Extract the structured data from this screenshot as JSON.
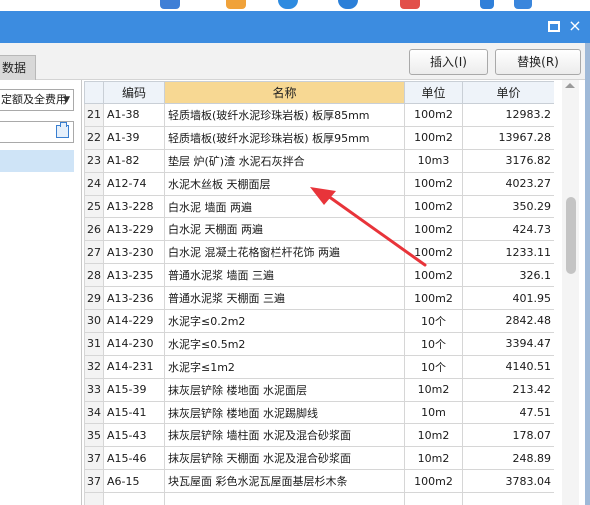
{
  "window": {
    "toolbar_icons": [
      "calendar-icon",
      "refresh-icon",
      "shield-icon",
      "globe-icon",
      "badge-icon",
      "user-icon",
      "grid-icon"
    ],
    "close_glyph": "×"
  },
  "toolbar": {
    "tab_label": "数据",
    "insert_label": "插入(I)",
    "replace_label": "替换(R)"
  },
  "left_panel": {
    "select_value": "定额及全费用"
  },
  "table": {
    "headers": [
      "编码",
      "名称",
      "单位",
      "单价"
    ],
    "rows": [
      {
        "idx": "21",
        "code": "A1-38",
        "name": "轻质墙板(玻纤水泥珍珠岩板) 板厚85mm",
        "unit": "100m2",
        "price": "12983.2"
      },
      {
        "idx": "22",
        "code": "A1-39",
        "name": "轻质墙板(玻纤水泥珍珠岩板) 板厚95mm",
        "unit": "100m2",
        "price": "13967.28"
      },
      {
        "idx": "23",
        "code": "A1-82",
        "name": "垫层 炉(矿)渣 水泥石灰拌合",
        "unit": "10m3",
        "price": "3176.82"
      },
      {
        "idx": "24",
        "code": "A12-74",
        "name": "水泥木丝板 天棚面层",
        "unit": "100m2",
        "price": "4023.27"
      },
      {
        "idx": "25",
        "code": "A13-228",
        "name": "白水泥 墙面 两遍",
        "unit": "100m2",
        "price": "350.29"
      },
      {
        "idx": "26",
        "code": "A13-229",
        "name": "白水泥 天棚面 两遍",
        "unit": "100m2",
        "price": "424.73"
      },
      {
        "idx": "27",
        "code": "A13-230",
        "name": "白水泥 混凝土花格窗栏杆花饰 两遍",
        "unit": "100m2",
        "price": "1233.11"
      },
      {
        "idx": "28",
        "code": "A13-235",
        "name": "普通水泥浆 墙面 三遍",
        "unit": "100m2",
        "price": "326.1"
      },
      {
        "idx": "29",
        "code": "A13-236",
        "name": "普通水泥浆 天棚面 三遍",
        "unit": "100m2",
        "price": "401.95"
      },
      {
        "idx": "30",
        "code": "A14-229",
        "name": "水泥字≤0.2m2",
        "unit": "10个",
        "price": "2842.48"
      },
      {
        "idx": "31",
        "code": "A14-230",
        "name": "水泥字≤0.5m2",
        "unit": "10个",
        "price": "3394.47"
      },
      {
        "idx": "32",
        "code": "A14-231",
        "name": "水泥字≤1m2",
        "unit": "10个",
        "price": "4140.51"
      },
      {
        "idx": "33",
        "code": "A15-39",
        "name": "抹灰层铲除 楼地面 水泥面层",
        "unit": "10m2",
        "price": "213.42"
      },
      {
        "idx": "34",
        "code": "A15-41",
        "name": "抹灰层铲除 楼地面 水泥踢脚线",
        "unit": "10m",
        "price": "47.51"
      },
      {
        "idx": "35",
        "code": "A15-43",
        "name": "抹灰层铲除 墙柱面 水泥及混合砂浆面",
        "unit": "10m2",
        "price": "178.07"
      },
      {
        "idx": "37",
        "code": "A15-46",
        "name": "抹灰层铲除 天棚面 水泥及混合砂浆面",
        "unit": "10m2",
        "price": "248.89"
      },
      {
        "idx": "37",
        "code": "A6-15",
        "name": "块瓦屋面 彩色水泥瓦屋面基层杉木条",
        "unit": "100m2",
        "price": "3783.04"
      },
      {
        "idx": "",
        "code": "",
        "name": "",
        "unit": "",
        "price": ""
      }
    ]
  },
  "annotation": {
    "color": "#e8343a"
  }
}
